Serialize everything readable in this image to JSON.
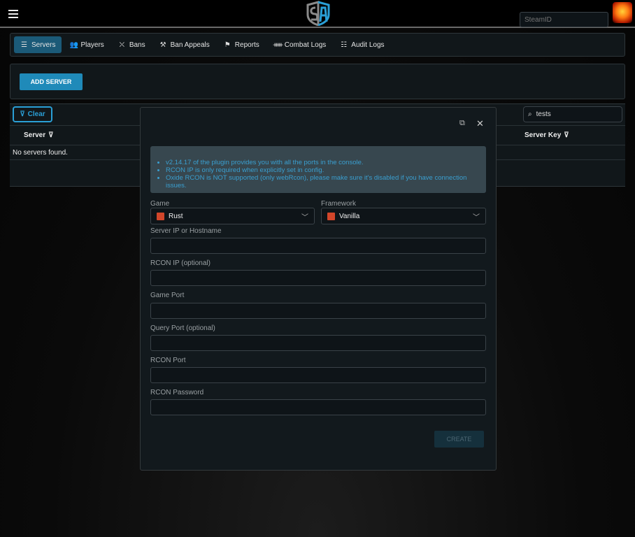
{
  "header": {
    "steamid_placeholder": "SteamID",
    "logo_text": "SA"
  },
  "nav": {
    "tabs": [
      {
        "label": "Servers",
        "icon": "server-icon",
        "active": true
      },
      {
        "label": "Players",
        "icon": "users-icon"
      },
      {
        "label": "Bans",
        "icon": "ban-user-icon"
      },
      {
        "label": "Ban Appeals",
        "icon": "gavel-icon"
      },
      {
        "label": "Reports",
        "icon": "flag-icon"
      },
      {
        "label": "Combat Logs",
        "icon": "combat-icon"
      },
      {
        "label": "Audit Logs",
        "icon": "list-icon"
      }
    ]
  },
  "add_server_label": "ADD SERVER",
  "table": {
    "clear_label": "Clear",
    "search_value": "tests",
    "columns": [
      "Server",
      "Server Key"
    ],
    "empty_message": "No servers found."
  },
  "modal": {
    "notes": [
      "v2.14.17 of the plugin provides you with all the ports in the console.",
      "RCON IP is only required when explicitly set in config.",
      "Oxide RCON is NOT supported (only webRcon), please make sure it's disabled if you have connection issues."
    ],
    "game_label": "Game",
    "game_value": "Rust",
    "framework_label": "Framework",
    "framework_value": "Vanilla",
    "fields": [
      "Server IP or Hostname",
      "RCON IP (optional)",
      "Game Port",
      "Query Port (optional)",
      "RCON Port",
      "RCON Password"
    ],
    "create_label": "CREATE"
  },
  "colors": {
    "accent": "#2a9fd6",
    "active_tab": "#1b5a78",
    "alert_bg": "#37474f",
    "alert_text": "#3a9fd0"
  }
}
